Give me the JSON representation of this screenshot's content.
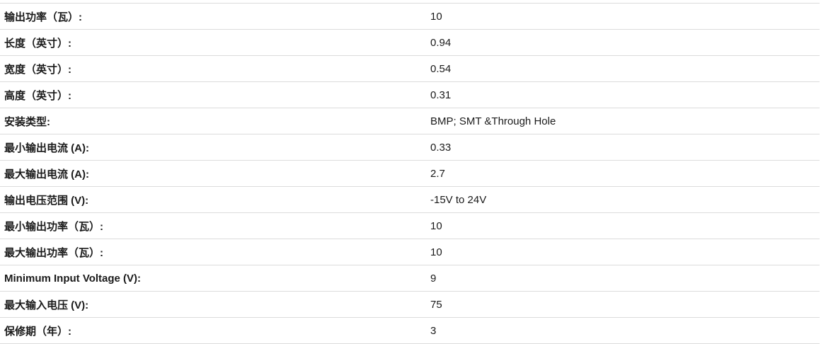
{
  "specs": [
    {
      "label": "输出功率（瓦）:",
      "value": "10"
    },
    {
      "label": "长度（英寸）:",
      "value": "0.94"
    },
    {
      "label": "宽度（英寸）:",
      "value": "0.54"
    },
    {
      "label": "高度（英寸）:",
      "value": "0.31"
    },
    {
      "label": "安装类型:",
      "value": "BMP; SMT &Through Hole"
    },
    {
      "label": "最小输出电流 (A):",
      "value": "0.33"
    },
    {
      "label": "最大输出电流 (A):",
      "value": "2.7"
    },
    {
      "label": "输出电压范围 (V):",
      "value": "-15V to 24V"
    },
    {
      "label": "最小输出功率（瓦）:",
      "value": "10"
    },
    {
      "label": "最大输出功率（瓦）:",
      "value": "10"
    },
    {
      "label": "Minimum Input Voltage (V):",
      "value": "9"
    },
    {
      "label": "最大输入电压 (V):",
      "value": "75"
    },
    {
      "label": "保修期（年）:",
      "value": "3"
    }
  ]
}
